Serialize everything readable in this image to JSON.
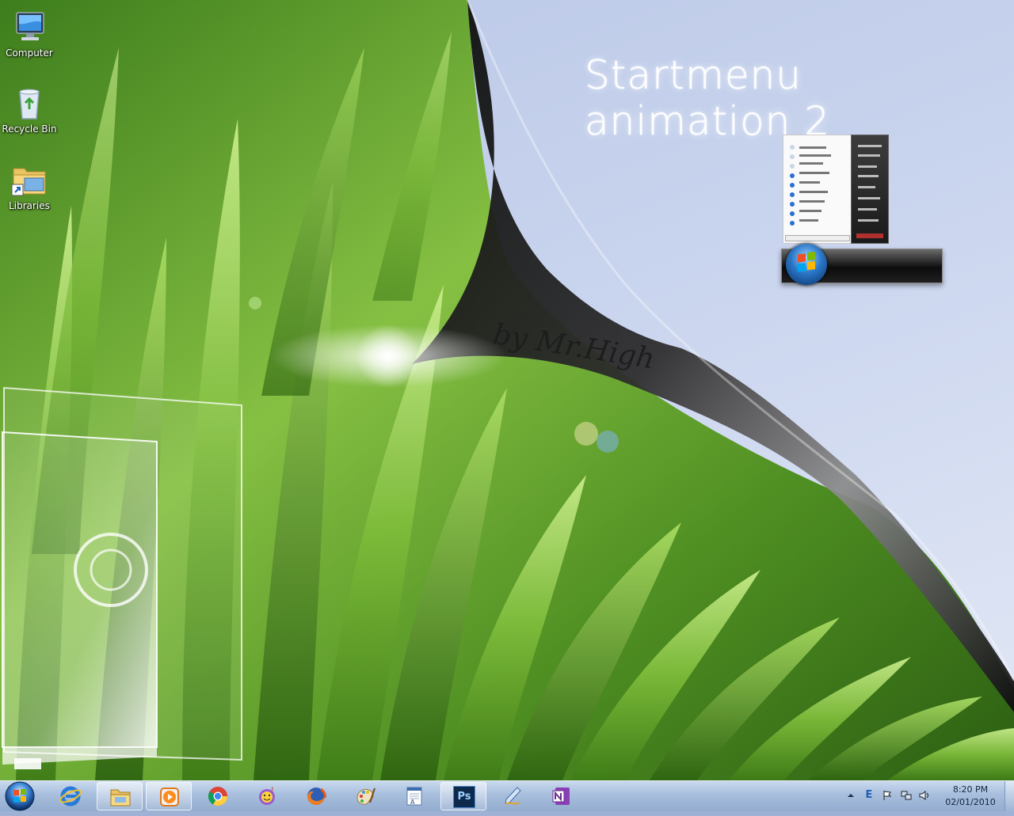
{
  "desktop": {
    "icons": [
      {
        "label": "Computer",
        "icon": "computer-icon"
      },
      {
        "label": "Recycle Bin",
        "icon": "recycle-bin-icon"
      },
      {
        "label": "Libraries",
        "icon": "libraries-folder-icon"
      }
    ]
  },
  "wallpaper": {
    "title": "Startmenu animation 2",
    "author": "by Mr.High"
  },
  "taskbar": {
    "start_icon": "windows-start-orb-icon",
    "items": [
      {
        "name": "internet-explorer",
        "icon": "internet-explorer-icon",
        "active": false
      },
      {
        "name": "windows-explorer",
        "icon": "folder-explorer-icon",
        "active": true
      },
      {
        "name": "media-player",
        "icon": "media-player-icon",
        "active": true
      },
      {
        "name": "chrome",
        "icon": "chrome-icon",
        "active": false
      },
      {
        "name": "messenger",
        "icon": "messenger-icon",
        "active": false
      },
      {
        "name": "firefox",
        "icon": "firefox-icon",
        "active": false
      },
      {
        "name": "paint",
        "icon": "paint-icon",
        "active": false
      },
      {
        "name": "wordpad",
        "icon": "wordpad-icon",
        "active": false
      },
      {
        "name": "photoshop",
        "icon": "photoshop-icon",
        "active": true,
        "text": "Ps"
      },
      {
        "name": "pen-tool",
        "icon": "pen-tool-icon",
        "active": false
      },
      {
        "name": "onenote",
        "icon": "onenote-icon",
        "active": false
      }
    ],
    "tray": {
      "icons": [
        "show-hidden-icons-arrow",
        "e-letter-icon",
        "action-center-flag-icon",
        "network-icon",
        "volume-icon"
      ]
    },
    "clock": {
      "time": "8:20 PM",
      "date": "02/01/2010"
    }
  },
  "colors": {
    "taskbar": "#a7bedc",
    "grass": "#6fae2f",
    "sky": "#c9d4ee"
  }
}
